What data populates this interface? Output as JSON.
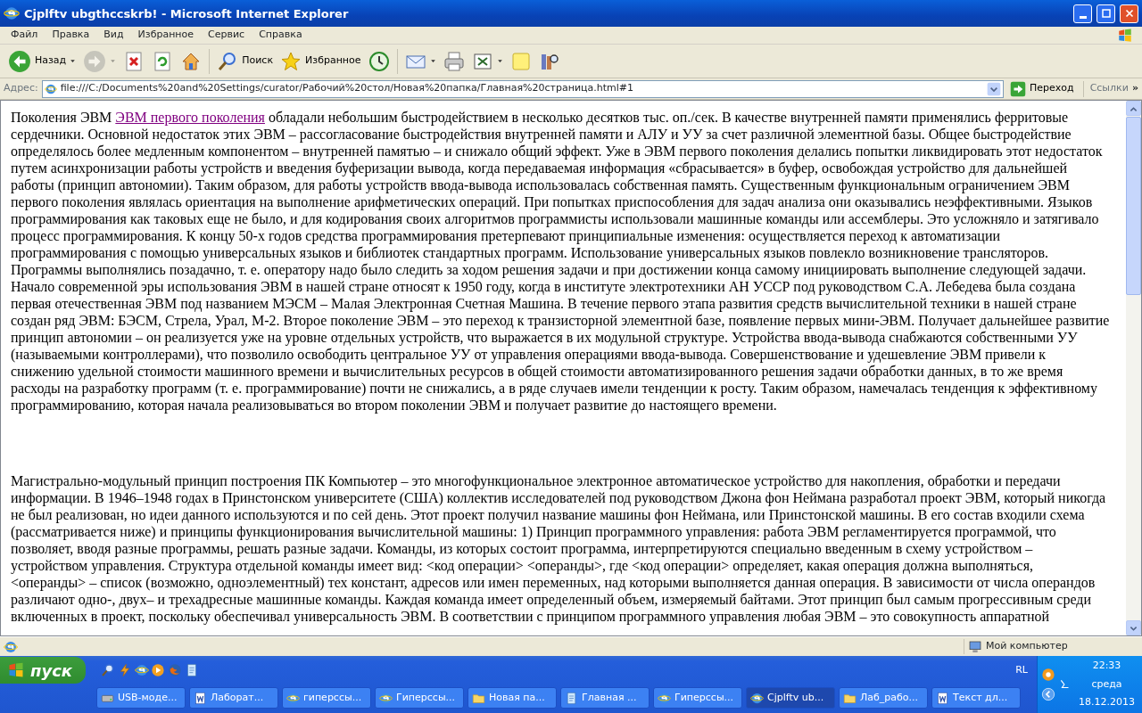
{
  "window": {
    "title": "Cjplftv ubgthccskrb! - Microsoft Internet Explorer"
  },
  "menu": [
    {
      "label": "Файл"
    },
    {
      "label": "Правка"
    },
    {
      "label": "Вид"
    },
    {
      "label": "Избранное"
    },
    {
      "label": "Сервис"
    },
    {
      "label": "Справка"
    }
  ],
  "toolbar": [
    {
      "kind": "back",
      "label": "Назад",
      "dropdown": true,
      "disabled": false
    },
    {
      "kind": "forward",
      "dropdown": true,
      "disabled": true
    },
    {
      "kind": "stop",
      "dropdown": false,
      "disabled": false
    },
    {
      "kind": "refresh",
      "dropdown": false,
      "disabled": false
    },
    {
      "kind": "home",
      "dropdown": false,
      "disabled": false
    },
    {
      "kind": "search",
      "label": "Поиск",
      "dropdown": false,
      "disabled": false
    },
    {
      "kind": "favorites",
      "label": "Избранное",
      "dropdown": false,
      "disabled": false
    },
    {
      "kind": "history",
      "dropdown": false,
      "disabled": false
    },
    {
      "kind": "mail",
      "dropdown": true,
      "disabled": false
    },
    {
      "kind": "print",
      "dropdown": false,
      "disabled": false
    },
    {
      "kind": "edit",
      "dropdown": true,
      "disabled": false
    },
    {
      "kind": "notes",
      "dropdown": false,
      "disabled": false
    },
    {
      "kind": "research",
      "dropdown": false,
      "disabled": false
    }
  ],
  "address_bar": {
    "label": "Адрес:",
    "value": "file:///C:/Documents%20and%20Settings/curator/Рабочий%20стол/Новая%20папка/Главная%20страница.html#1",
    "go": "Переход",
    "links": "Ссылки",
    "more": "»"
  },
  "content": {
    "paragraphs": [
      {
        "parts": [
          {
            "kind": "text",
            "text": "Поколения ЭВМ "
          },
          {
            "kind": "link",
            "text": "ЭВМ первого поколения"
          },
          {
            "kind": "text",
            "text": " обладали небольшим быстродействием в несколько десятков тыс. оп./сек. В качестве внутренней памяти применялись ферритовые сердечники. Основной недостаток этих ЭВМ – рассогласование быстродействия внутренней памяти и АЛУ и УУ за счет различной элементной базы. Общее быстродействие определялось более медленным компонентом – внутренней памятью – и снижало общий эффект. Уже в ЭВМ первого поколения делались попытки ликвидировать этот недостаток путем асинхронизации работы устройств и введения буферизации вывода, когда передаваемая информация «сбрасывается» в буфер, освобождая устройство для дальнейшей работы (принцип автономии). Таким образом, для работы устройств ввода-вывода использовалась собственная память. Существенным функциональным ограничением ЭВМ первого поколения являлась ориентация на выполнение арифметических операций. При попытках приспособления для задач анализа они оказывались неэффективными. Языков программирования как таковых еще не было, и для кодирования своих алгоритмов программисты использовали машинные команды или ассемблеры. Это усложняло и затягивало процесс программирования. К концу 50-х годов средства программирования претерпевают принципиальные изменения: осуществляется переход к автоматизации программирования с помощью универсальных языков и библиотек стандартных программ. Использование универсальных языков повлекло возникновение трансляторов. Программы выполнялись позадачно, т. е. оператору надо было следить за ходом решения задачи и при достижении конца самому инициировать выполнение следующей задачи. Начало современной эры использования ЭВМ в нашей стране относят к 1950 году, когда в институте электротехники АН УССР под руководством С.А. Лебедева была создана первая отечественная ЭВМ под названием МЭСМ – Малая Электронная Счетная Машина. В течение первого этапа развития средств вычислительной техники в нашей стране создан ряд ЭВМ: БЭСМ, Стрела, Урал, М-2. Второе поколение ЭВМ – это переход к транзисторной элементной базе, появление первых мини-ЭВМ. Получает дальнейшее развитие принцип автономии – он реализуется уже на уровне отдельных устройств, что выражается в их модульной структуре. Устройства ввода-вывода снабжаются собственными УУ (называемыми контроллерами), что позволило освободить центральное УУ от управления операциями ввода-вывода. Совершенствование и удешевление ЭВМ привели к снижению удельной стоимости машинного времени и вычислительных ресурсов в общей стоимости автоматизированного решения задачи обработки данных, в то же время расходы на разработку программ (т. е. программирование) почти не снижались, а в ряде случаев имели тенденции к росту. Таким образом, намечалась тенденция к эффективному программированию, которая начала реализовываться во втором поколении ЭВМ и получает развитие до настоящего времени."
          }
        ]
      },
      {
        "parts": [
          {
            "kind": "text",
            "text": "Магистрально-модульный принцип построения ПК Компьютер – это многофункциональное электронное автоматическое устройство для накопления, обработки и передачи информации. В 1946–1948 годах в Принстонском университете (США) коллектив исследователей под руководством Джона фон Неймана разработал проект ЭВМ, который никогда не был реализован, но идеи данного используются и по сей день. Этот проект получил название машины фон Неймана, или Принстонской машины. В его состав входили схема (рассматривается ниже) и принципы функционирования вычислительной машины: 1) Принцип программного управления: работа ЭВМ регламентируется программой, что позволяет, вводя разные программы, решать разные задачи. Команды, из которых состоит программа, интерпретируются специально введенным в схему устройством – устройством управления. Структура отдельной команды имеет вид: <код операции> <операнды>, где <код операции> определяет, какая операция должна выполняться, <операнды> – список (возможно, одноэлементный) тех констант, адресов или имен переменных, над которыми выполняется данная операция. В зависимости от числа операндов различают одно-, двух– и трехадресные машинные команды. Каждая команда имеет определенный объем, измеряемый байтами. Этот принцип был самым прогрессивным среди включенных в проект, поскольку обеспечивал универсальность ЭВМ. В соответствии с принципом программного управления любая ЭВМ – это совокупность аппаратной"
          }
        ]
      }
    ]
  },
  "status_bar": {
    "zone": "Мой компьютер"
  },
  "taskbar": {
    "start": "пуск",
    "quick_launch": [
      {
        "kind": "search"
      },
      {
        "kind": "bolt"
      },
      {
        "kind": "ie"
      },
      {
        "kind": "media"
      },
      {
        "kind": "firefox"
      },
      {
        "kind": "doc"
      }
    ],
    "language": "RL",
    "tasks": [
      {
        "kind": "usb",
        "label": "USB-моде...",
        "selected": false
      },
      {
        "kind": "word",
        "label": "Лаборат...",
        "selected": false
      },
      {
        "kind": "ie",
        "label": "гиперссы...",
        "selected": false
      },
      {
        "kind": "ie",
        "label": "Гиперссы...",
        "selected": false
      },
      {
        "kind": "folder",
        "label": "Новая па...",
        "selected": false
      },
      {
        "kind": "doc",
        "label": "Главная ...",
        "selected": false
      },
      {
        "kind": "ie",
        "label": "Гиперссы...",
        "selected": false
      },
      {
        "kind": "ie",
        "label": "Cjplftv ub...",
        "selected": true
      },
      {
        "kind": "folder",
        "label": "Лаб_рабо...",
        "selected": false
      },
      {
        "kind": "word",
        "label": "Текст дл...",
        "selected": false
      }
    ],
    "clock": {
      "time": "22:33",
      "day": "среда",
      "date": "18.12.2013"
    }
  }
}
